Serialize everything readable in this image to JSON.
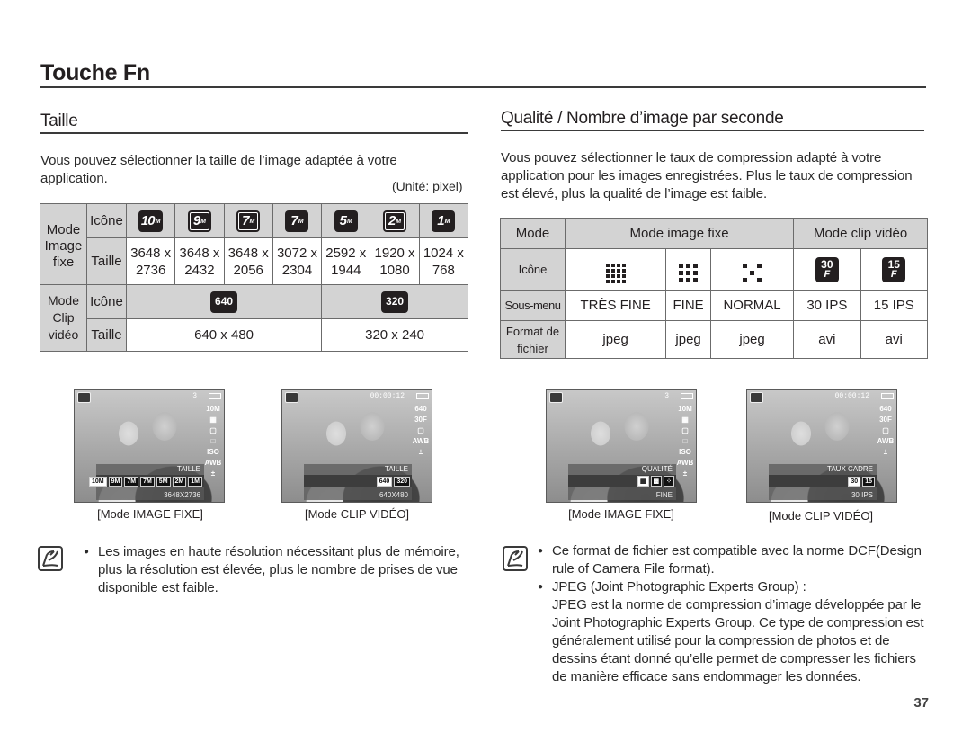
{
  "page": {
    "title": "Touche Fn",
    "page_number": "37"
  },
  "left": {
    "section_title": "Taille",
    "intro": "Vous pouvez sélectionner la taille de l’image adaptée à votre application.",
    "unit_label": "(Unité: pixel)",
    "table": {
      "still_mode_label": "Mode Image fixe",
      "clip_mode_label": "Mode Clip vidéo",
      "icon_label": "Icône",
      "size_label": "Taille",
      "still_sizes": [
        {
          "icon": "10M",
          "width": "3648 x",
          "height": "2736"
        },
        {
          "icon": "9M",
          "width": "3648 x",
          "height": "2432"
        },
        {
          "icon": "7M",
          "width": "3648 x",
          "height": "2056"
        },
        {
          "icon": "7M",
          "width": "3072 x",
          "height": "2304"
        },
        {
          "icon": "5M",
          "width": "2592 x",
          "height": "1944"
        },
        {
          "icon": "2M",
          "width": "1920 x",
          "height": "1080"
        },
        {
          "icon": "1M",
          "width": "1024 x",
          "height": "768"
        }
      ],
      "clip_sizes": [
        {
          "icon": "640",
          "size": "640 x 480"
        },
        {
          "icon": "320",
          "size": "320 x 240"
        }
      ]
    },
    "screens": [
      {
        "caption": "[Mode IMAGE FIXE]",
        "top_text": "3",
        "side_icons": [
          "10M",
          "▦",
          "▢",
          "□",
          "ISO",
          "AWB",
          "±"
        ],
        "menu_title": "TAILLE",
        "menu_options": [
          "10M",
          "9M",
          "7M",
          "7M",
          "5M",
          "2M",
          "1M"
        ],
        "menu_value": "3648X2736"
      },
      {
        "caption": "[Mode CLIP VIDÉO]",
        "top_text": "00:00:12",
        "side_icons": [
          "640",
          "30F",
          "▢",
          "AWB",
          "±"
        ],
        "menu_title": "TAILLE",
        "menu_options": [
          "640",
          "320"
        ],
        "menu_value": "640X480"
      }
    ],
    "note": {
      "bullets": [
        "Les images en haute résolution nécessitant plus de mémoire, plus la résolution est élevée, plus le nombre de prises de vue disponible est faible."
      ]
    }
  },
  "right": {
    "section_title": "Qualité / Nombre d’image par seconde",
    "intro": "Vous pouvez sélectionner le taux de compression adapté à votre application pour les images enregistrées. Plus le taux de compression est élevé, plus la qualité de l’image est faible.",
    "table": {
      "mode_label": "Mode",
      "still_mode_label": "Mode image fixe",
      "clip_mode_label": "Mode clip vidéo",
      "icon_label": "Icône",
      "submenu_label": "Sous-menu",
      "format_label": "Format de fichier",
      "columns": [
        {
          "icon": "very-fine-quality",
          "submenu": "TRÈS FINE",
          "format": "jpeg"
        },
        {
          "icon": "fine-quality",
          "submenu": "FINE",
          "format": "jpeg"
        },
        {
          "icon": "normal-quality",
          "submenu": "NORMAL",
          "format": "jpeg"
        },
        {
          "icon": "30",
          "submenu": "30 IPS",
          "format": "avi"
        },
        {
          "icon": "15",
          "submenu": "15 IPS",
          "format": "avi"
        }
      ]
    },
    "screens": [
      {
        "caption": "[Mode IMAGE FIXE]",
        "top_text": "3",
        "side_icons": [
          "10M",
          "▦",
          "▢",
          "□",
          "ISO",
          "AWB",
          "±"
        ],
        "menu_title": "QUALITÉ",
        "menu_options": [
          "▦",
          "▩",
          "⁘"
        ],
        "menu_value": "FINE"
      },
      {
        "caption": "[Mode CLIP VIDÉO]",
        "top_text": "00:00:12",
        "side_icons": [
          "640",
          "30F",
          "▢",
          "AWB",
          "±"
        ],
        "menu_title": "TAUX CADRE",
        "menu_options": [
          "30",
          "15"
        ],
        "menu_value": "30 IPS"
      }
    ],
    "note": {
      "bullet1": "Ce format de fichier est compatible avec la norme DCF(Design rule of Camera File format).",
      "bullet2_title": "JPEG (Joint Photographic Experts Group) :",
      "bullet2_body": "JPEG est la norme de compression d’image développée par le Joint Photographic Experts Group. Ce type de compression est généralement utilisé pour la compression de photos et de dessins étant donné qu’elle permet de compresser les fichiers de manière efficace sans endommager les données."
    }
  }
}
